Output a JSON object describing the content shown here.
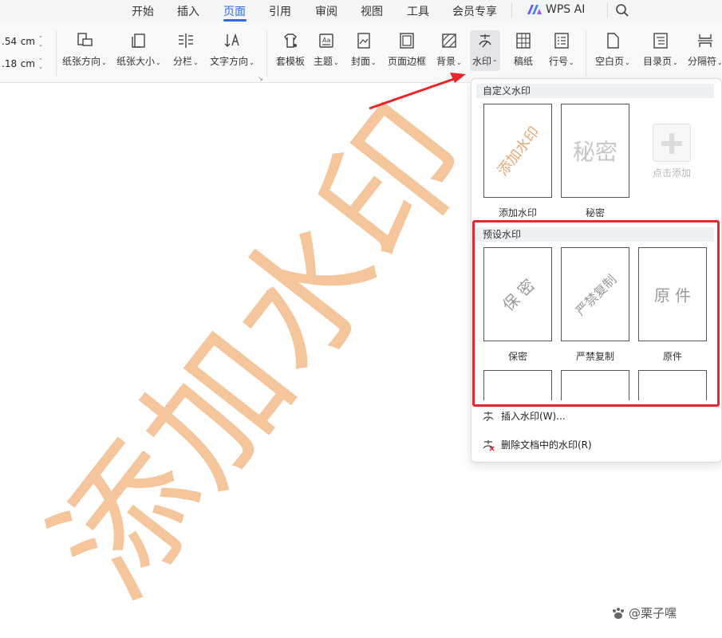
{
  "menubar": {
    "items": [
      "开始",
      "插入",
      "页面",
      "引用",
      "审阅",
      "视图",
      "工具",
      "会员专享"
    ],
    "active_index": 2,
    "wps_ai": "WPS AI",
    "accent_color": "#2b6de0"
  },
  "ribbon": {
    "margins": [
      {
        "value": ".54",
        "unit": "cm"
      },
      {
        "value": ".18",
        "unit": "cm"
      }
    ],
    "buttons": {
      "orientation": "纸张方向",
      "size": "纸张大小",
      "columns": "分栏",
      "text_direction": "文字方向",
      "template": "套模板",
      "theme": "主题",
      "cover": "封面",
      "page_border": "页面边框",
      "background": "背景",
      "watermark": "水印",
      "manuscript": "稿纸",
      "line_number": "行号",
      "blank_page": "空白页",
      "toc_page": "目录页",
      "separator": "分隔符"
    }
  },
  "document": {
    "watermark_text": "添加水印",
    "watermark_color": "#f5c59b"
  },
  "watermark_panel": {
    "custom_header": "自定义水印",
    "custom_tiles": [
      {
        "preview": "添加水印",
        "label": "添加水印"
      },
      {
        "preview": "秘密",
        "label": "秘密"
      }
    ],
    "add_label": "点击添加",
    "preset_header": "预设水印",
    "preset_tiles": [
      {
        "preview": "保 密",
        "label": "保密"
      },
      {
        "preview": "严禁复制",
        "label": "严禁复制"
      },
      {
        "preview": "原 件",
        "label": "原件"
      }
    ],
    "insert_action": "插入水印(W)...",
    "delete_action": "删除文档中的水印(R)",
    "highlight_color": "#e8262b"
  },
  "credit": "@栗子嘿"
}
